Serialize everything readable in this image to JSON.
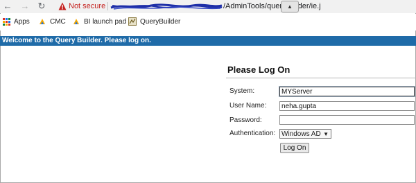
{
  "browser": {
    "security_label": "Not secure",
    "url_visible": "/AdminTools/querybuilder/ie.j",
    "bookmarks": [
      {
        "label": "Apps",
        "icon": "apps-grid-icon"
      },
      {
        "label": "CMC",
        "icon": "cmc-icon"
      },
      {
        "label": "BI launch pad",
        "icon": "bi-launch-pad-icon"
      },
      {
        "label": "QueryBuilder",
        "icon": "querybuilder-icon"
      }
    ]
  },
  "banner": {
    "welcome": "Welcome to the Query Builder. Please log on."
  },
  "login": {
    "title": "Please Log On",
    "system_label": "System:",
    "system_value": "MYServer",
    "username_label": "User Name:",
    "username_value": "neha.gupta",
    "password_label": "Password:",
    "password_value": "",
    "auth_label": "Authentication:",
    "auth_value": "Windows AD",
    "logon_button": "Log On"
  },
  "colors": {
    "banner_bg": "#1f6ba8",
    "not_secure": "#c5221f"
  }
}
